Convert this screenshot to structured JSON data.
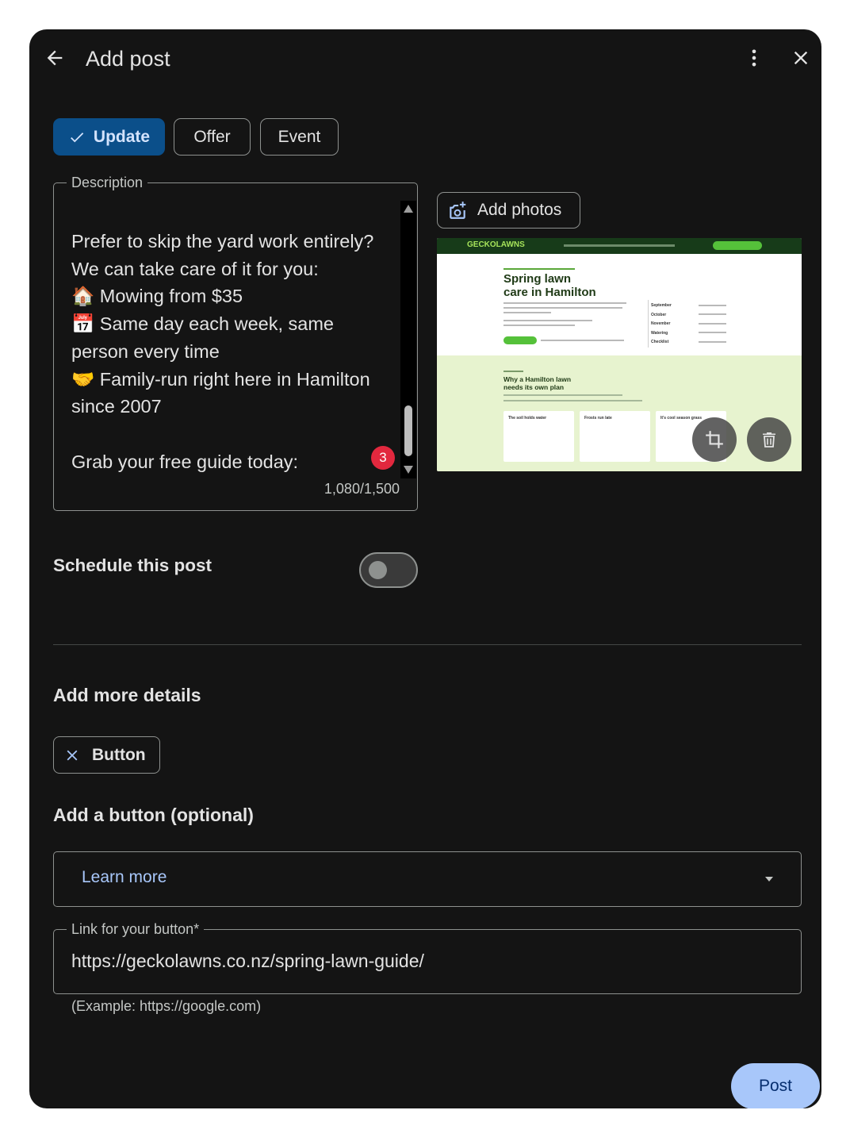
{
  "header": {
    "title": "Add post"
  },
  "post_types": [
    {
      "label": "Update",
      "selected": true
    },
    {
      "label": "Offer",
      "selected": false
    },
    {
      "label": "Event",
      "selected": false
    }
  ],
  "description": {
    "label": "Description",
    "text": "Prefer to skip the yard work entirely?\nWe can take care of it for you:\n🏠 Mowing from $35\n📅 Same day each week, same person every time\n🤝 Family-run right here in Hamilton since 2007\n\nGrab your free guide today:",
    "counter": "1,080/1,500",
    "badge_count": "3"
  },
  "photos": {
    "add_label": "Add photos",
    "preview": {
      "logo": "GECKOLAWNS",
      "headline_line1": "Spring lawn",
      "headline_line2": "care in Hamilton",
      "section_title_line1": "Why a Hamilton lawn",
      "section_title_line2": "needs its own plan",
      "table_rows": [
        "September",
        "October",
        "November",
        "Watering",
        "Checklist"
      ],
      "cards": [
        "The soil holds water",
        "Frosts run late",
        "It's cool season grass"
      ]
    }
  },
  "schedule": {
    "label": "Schedule this post",
    "enabled": false
  },
  "more_details": {
    "heading": "Add more details",
    "chip_label": "Button"
  },
  "button_section": {
    "heading": "Add a button (optional)",
    "selected_option": "Learn more",
    "link_label": "Link for your button*",
    "link_value": "https://geckolawns.co.nz/spring-lawn-guide/",
    "link_hint": "(Example: https://google.com)"
  },
  "actions": {
    "post_label": "Post"
  },
  "colors": {
    "dialog_bg": "#141414",
    "selected_chip": "#0b4f8a",
    "primary_button": "#a8c7fa",
    "badge": "#e2283e",
    "link_text": "#a8c7fa"
  }
}
